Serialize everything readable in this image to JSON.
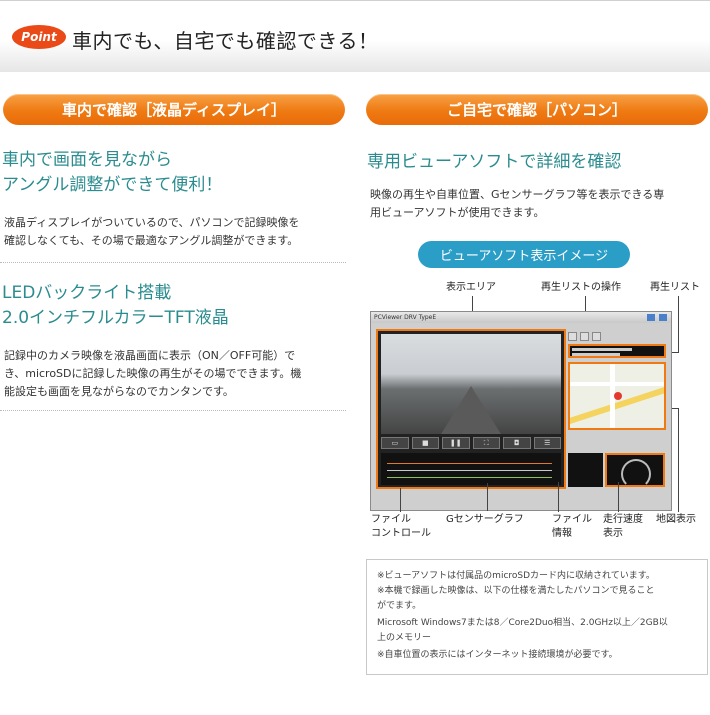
{
  "header": {
    "badge": "Point",
    "title": "車内でも、自宅でも確認できる！"
  },
  "left": {
    "pill": "車内で確認［液晶ディスプレイ］",
    "heading1_line1": "車内で画面を見ながら",
    "heading1_line2": "アングル調整ができて便利！",
    "body1_line1": "液晶ディスプレイがついているので、パソコンで記録映像を",
    "body1_line2": "確認しなくても、その場で最適なアングル調整ができます。",
    "heading2_line1": "LEDバックライト搭載",
    "heading2_line2": "2.0インチフルカラーTFT液晶",
    "body2_line1": "記録中のカメラ映像を液晶画面に表示（ON／OFF可能）で",
    "body2_line2": "き、microSDに記録した映像の再生がその場でできます。機",
    "body2_line3": "能設定も画面を見ながらなのでカンタンです。"
  },
  "right": {
    "pill": "ご自宅で確認［パソコン］",
    "heading": "専用ビューアソフトで詳細を確認",
    "body_line1": "映像の再生や自車位置、Gセンサーグラフ等を表示できる専",
    "body_line2": "用ビューアソフトが使用できます。",
    "image_pill": "ビューアソフト表示イメージ"
  },
  "viewer": {
    "window_title": "PCViewer  DRV TypeE",
    "labels": {
      "display_area": "表示エリア",
      "playlist_ops": "再生リストの操作",
      "playlist": "再生リスト",
      "file_control_1": "ファイル",
      "file_control_2": "コントロール",
      "g_sensor": "Gセンサーグラフ",
      "file_info_1": "ファイル",
      "file_info_2": "情報",
      "speed_1": "走行速度",
      "speed_2": "表示",
      "map": "地図表示"
    },
    "tool_buttons": [
      "+",
      "−",
      "□"
    ]
  },
  "notes": {
    "line1": "※ビューアソフトは付属品のmicroSDカード内に収納されています。",
    "line2": "※本機で録画した映像は、以下の仕様を満たしたパソコンで見ること",
    "line3": "がでます。",
    "line4": "Microsoft Windows7または8／Core2Duo相当、2.0GHz以上／2GB以",
    "line5": "上のメモリー",
    "line6": "※自車位置の表示にはインターネット接続環境が必要です。"
  }
}
